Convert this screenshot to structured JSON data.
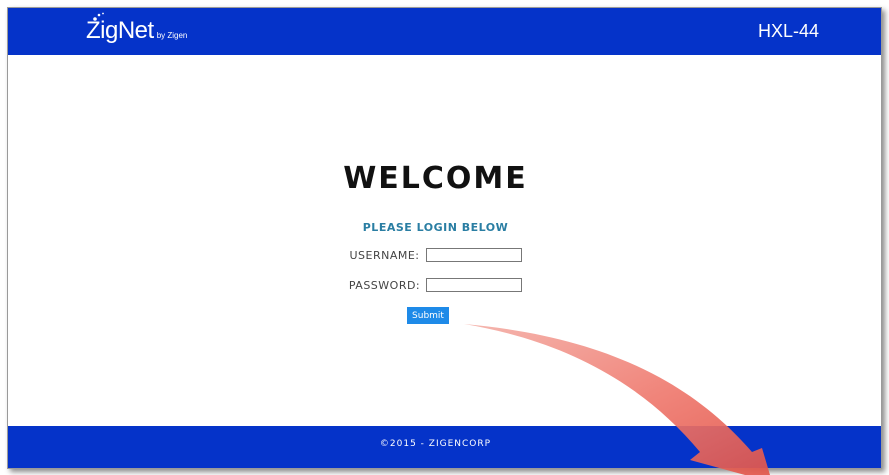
{
  "header": {
    "logo_main": "ZigNet",
    "logo_sub": "by Zigen",
    "device_id": "HXL-44"
  },
  "login": {
    "welcome": "WELCOME",
    "subtitle": "PLEASE LOGIN BELOW",
    "username_label": "USERNAME:",
    "username_value": "",
    "password_label": "PASSWORD:",
    "password_value": "",
    "submit_label": "Submit"
  },
  "footer": {
    "copyright": "©2015 - ZIGENCORP"
  },
  "colors": {
    "brand_blue": "#0533c9",
    "button_blue": "#1e8ae8",
    "subtitle_teal": "#2a7ea3",
    "annotation_arrow": "#ee6b61"
  },
  "icons": {
    "annotation": "pointer-arrow-icon"
  }
}
